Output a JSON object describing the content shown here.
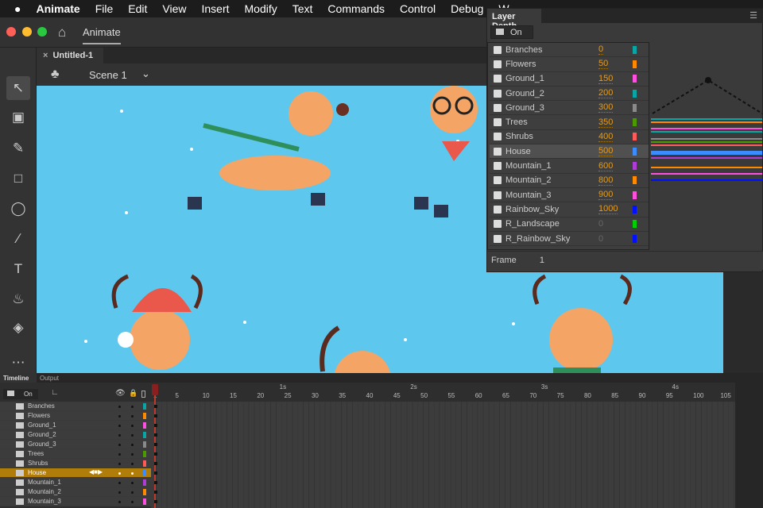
{
  "menubar": {
    "app": "Animate",
    "items": [
      "File",
      "Edit",
      "View",
      "Insert",
      "Modify",
      "Text",
      "Commands",
      "Control",
      "Debug",
      "W"
    ]
  },
  "titlebar": {
    "workspace": "Animate"
  },
  "document": {
    "tab": "Untitled-1",
    "scene": "Scene 1"
  },
  "layer_depth": {
    "title": "Layer Depth",
    "toggle": "On",
    "frame_label": "Frame",
    "frame_value": "1",
    "layers": [
      {
        "name": "Branches",
        "depth": "0",
        "color": "#0aa5a5"
      },
      {
        "name": "Flowers",
        "depth": "50",
        "color": "#ff8a00"
      },
      {
        "name": "Ground_1",
        "depth": "150",
        "color": "#ff4fe0"
      },
      {
        "name": "Ground_2",
        "depth": "200",
        "color": "#0aa5a5"
      },
      {
        "name": "Ground_3",
        "depth": "300",
        "color": "#8a8a8a"
      },
      {
        "name": "Trees",
        "depth": "350",
        "color": "#4a9a00"
      },
      {
        "name": "Shrubs",
        "depth": "400",
        "color": "#ff5a5a"
      },
      {
        "name": "House",
        "depth": "500",
        "color": "#3a8cff"
      },
      {
        "name": "Mountain_1",
        "depth": "600",
        "color": "#b03cd8"
      },
      {
        "name": "Mountain_2",
        "depth": "800",
        "color": "#ff8a00"
      },
      {
        "name": "Mountain_3",
        "depth": "900",
        "color": "#ff4fe0"
      },
      {
        "name": "Rainbow_Sky",
        "depth": "1000",
        "color": "#0010ff"
      },
      {
        "name": "R_Landscape",
        "depth": "0",
        "color": "#00d000"
      },
      {
        "name": "R_Rainbow_Sky",
        "depth": "0",
        "color": "#0010ff"
      }
    ]
  },
  "timeline": {
    "tabs": [
      "Timeline",
      "Output"
    ],
    "toggle": "On",
    "selected_layer": "House",
    "seconds": [
      "1s",
      "2s",
      "3s",
      "4s"
    ],
    "frames": [
      "1",
      "5",
      "10",
      "15",
      "20",
      "25",
      "30",
      "35",
      "40",
      "45",
      "50",
      "55",
      "60",
      "65",
      "70",
      "75",
      "80",
      "85",
      "90",
      "95",
      "100",
      "105"
    ]
  }
}
